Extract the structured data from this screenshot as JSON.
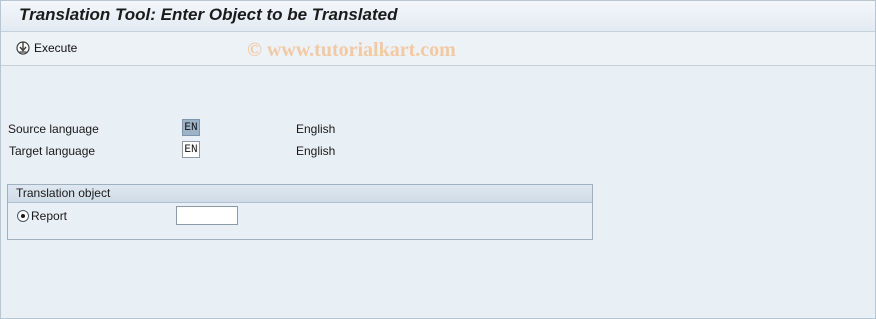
{
  "window": {
    "title": "Translation Tool: Enter Object to be Translated"
  },
  "toolbar": {
    "execute_label": "Execute",
    "execute_icon": "execute-icon"
  },
  "watermark": "© www.tutorialkart.com",
  "form": {
    "source_language_label": "Source language",
    "source_language_value": "EN",
    "source_language_name": "English",
    "target_language_label": "Target language",
    "target_language_value": "EN",
    "target_language_name": "English"
  },
  "translation_object": {
    "title": "Translation object",
    "report_label": "Report",
    "report_selected": true,
    "report_value": ""
  }
}
